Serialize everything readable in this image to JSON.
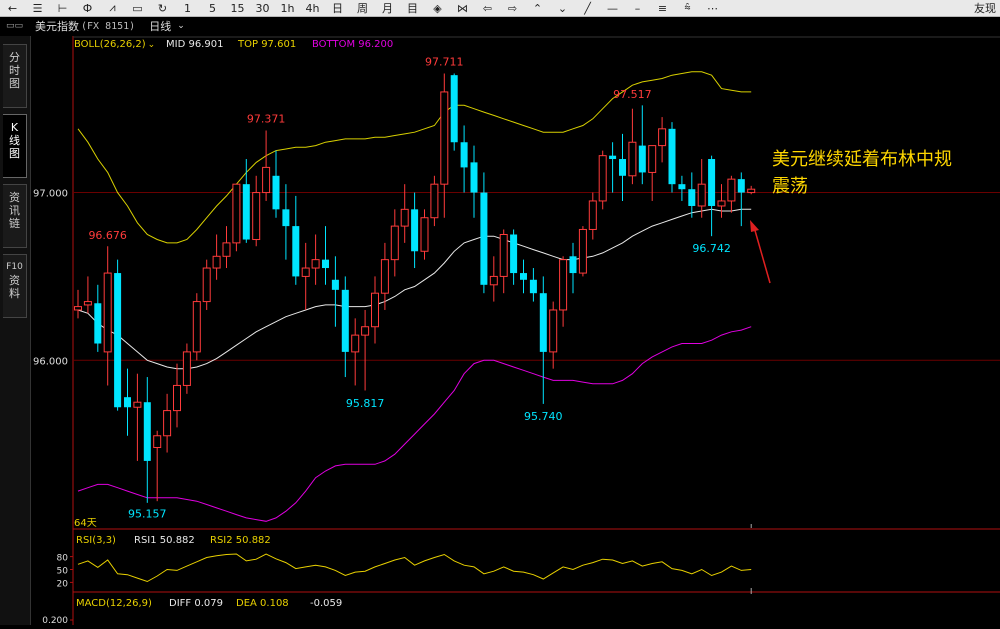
{
  "toolbar": {
    "items": [
      {
        "name": "back-arrow-icon",
        "glyph": "←"
      },
      {
        "name": "list-icon",
        "glyph": "☰"
      },
      {
        "name": "candlestick-icon",
        "glyph": "⊢"
      },
      {
        "name": "kline-icon",
        "glyph": "Ф"
      },
      {
        "name": "line-chart-icon",
        "glyph": "⩘"
      },
      {
        "name": "box-icon",
        "glyph": "▭"
      },
      {
        "name": "refresh-icon",
        "glyph": "↻"
      },
      {
        "name": "period-1",
        "label": "1"
      },
      {
        "name": "period-5",
        "label": "5"
      },
      {
        "name": "period-15",
        "label": "15"
      },
      {
        "name": "period-30",
        "label": "30"
      },
      {
        "name": "period-1h",
        "label": "1h"
      },
      {
        "name": "period-4h",
        "label": "4h"
      },
      {
        "name": "period-day",
        "label": "日"
      },
      {
        "name": "period-week",
        "label": "周"
      },
      {
        "name": "period-month",
        "label": "月"
      },
      {
        "name": "period-year",
        "label": "目"
      },
      {
        "name": "eye-icon",
        "glyph": "◈"
      },
      {
        "name": "cross-icon",
        "glyph": "⋈"
      },
      {
        "name": "arrow-left-icon",
        "glyph": "⇦"
      },
      {
        "name": "arrow-right-icon",
        "glyph": "⇨"
      },
      {
        "name": "zoom-in-icon",
        "glyph": "⌃"
      },
      {
        "name": "zoom-out-icon",
        "glyph": "⌄"
      },
      {
        "name": "draw-line-icon",
        "glyph": "╱"
      },
      {
        "name": "hline-icon",
        "glyph": "—"
      },
      {
        "name": "hline2-icon",
        "glyph": "–"
      },
      {
        "name": "channel-icon",
        "glyph": "≡"
      },
      {
        "name": "fib-icon",
        "glyph": "⩯"
      },
      {
        "name": "more-icon",
        "glyph": "⋯"
      }
    ],
    "right_label": "友现"
  },
  "titlebar": {
    "instrument": "美元指数",
    "symbol": "(FX 8151)",
    "period": "日线"
  },
  "sidetabs": [
    {
      "name": "tab-intraday",
      "chars": [
        "分",
        "时",
        "图"
      ],
      "active": false
    },
    {
      "name": "tab-kline",
      "chars": [
        "K",
        "线",
        "图"
      ],
      "active": true
    },
    {
      "name": "tab-news",
      "chars": [
        "资",
        "讯",
        "链"
      ],
      "active": false
    },
    {
      "name": "tab-f10",
      "chars": [
        "F10",
        "资",
        "料"
      ],
      "active": false
    }
  ],
  "main_legend": {
    "label": "BOLL(26,26,2)",
    "mid": "MID 96.901",
    "top": "TOP 97.601",
    "bottom": "BOTTOM 96.200"
  },
  "rsi_legend": {
    "label": "RSI(3,3)",
    "rsi1": "RSI1 50.882",
    "rsi2": "RSI2 50.882"
  },
  "macd_legend": {
    "label": "MACD(12,26,9)",
    "diff": "DIFF 0.079",
    "dea": "DEA 0.108",
    "macd": "-0.059"
  },
  "days_label": "64天",
  "annotation": {
    "line1": "美元继续延着布林中规",
    "line2": "震荡"
  },
  "colors": {
    "up": "#ff3b3b",
    "down": "#00e5ff",
    "boll_top": "#d8d000",
    "boll_mid": "#e8e8e8",
    "boll_bottom": "#e000e0",
    "legend_label": "#e8d000",
    "legend_mid": "#e8e8e8",
    "legend_top": "#e8d000",
    "legend_bottom": "#e000e0",
    "rsi_line": "#e8d000",
    "annotation": "#ffd700",
    "arrow": "#e02020"
  },
  "chart_data": {
    "type": "candlestick",
    "main": {
      "y_ticks": [
        "97.000",
        "96.000"
      ],
      "y_tick_values": [
        97.0,
        96.0
      ],
      "ylim": [
        95.0,
        97.85
      ],
      "candles": [
        {
          "o": 96.3,
          "h": 96.42,
          "l": 96.25,
          "c": 96.32
        },
        {
          "o": 96.33,
          "h": 96.5,
          "l": 96.28,
          "c": 96.35
        },
        {
          "o": 96.34,
          "h": 96.45,
          "l": 96.05,
          "c": 96.1
        },
        {
          "o": 96.05,
          "h": 96.68,
          "l": 95.85,
          "c": 96.52
        },
        {
          "o": 96.52,
          "h": 96.6,
          "l": 95.7,
          "c": 95.72
        },
        {
          "o": 95.78,
          "h": 95.95,
          "l": 95.55,
          "c": 95.72
        },
        {
          "o": 95.72,
          "h": 95.92,
          "l": 95.4,
          "c": 95.75
        },
        {
          "o": 95.75,
          "h": 95.9,
          "l": 95.15,
          "c": 95.4
        },
        {
          "o": 95.48,
          "h": 95.58,
          "l": 95.16,
          "c": 95.55
        },
        {
          "o": 95.55,
          "h": 95.8,
          "l": 95.45,
          "c": 95.7
        },
        {
          "o": 95.7,
          "h": 95.98,
          "l": 95.6,
          "c": 95.85
        },
        {
          "o": 95.85,
          "h": 96.1,
          "l": 95.8,
          "c": 96.05
        },
        {
          "o": 96.05,
          "h": 96.4,
          "l": 96.0,
          "c": 96.35
        },
        {
          "o": 96.35,
          "h": 96.6,
          "l": 96.3,
          "c": 96.55
        },
        {
          "o": 96.55,
          "h": 96.75,
          "l": 96.48,
          "c": 96.62
        },
        {
          "o": 96.62,
          "h": 96.8,
          "l": 96.55,
          "c": 96.7
        },
        {
          "o": 96.7,
          "h": 97.05,
          "l": 96.65,
          "c": 97.05
        },
        {
          "o": 97.05,
          "h": 97.2,
          "l": 96.7,
          "c": 96.72
        },
        {
          "o": 96.72,
          "h": 97.1,
          "l": 96.68,
          "c": 97.0
        },
        {
          "o": 97.0,
          "h": 97.37,
          "l": 96.95,
          "c": 97.15
        },
        {
          "o": 97.1,
          "h": 97.25,
          "l": 96.85,
          "c": 96.9
        },
        {
          "o": 96.9,
          "h": 97.05,
          "l": 96.6,
          "c": 96.8
        },
        {
          "o": 96.8,
          "h": 96.98,
          "l": 96.45,
          "c": 96.5
        },
        {
          "o": 96.5,
          "h": 96.7,
          "l": 96.3,
          "c": 96.55
        },
        {
          "o": 96.55,
          "h": 96.75,
          "l": 96.45,
          "c": 96.6
        },
        {
          "o": 96.6,
          "h": 96.8,
          "l": 96.45,
          "c": 96.55
        },
        {
          "o": 96.48,
          "h": 96.62,
          "l": 96.2,
          "c": 96.42
        },
        {
          "o": 96.42,
          "h": 96.5,
          "l": 95.9,
          "c": 96.05
        },
        {
          "o": 96.05,
          "h": 96.25,
          "l": 95.85,
          "c": 96.15
        },
        {
          "o": 96.15,
          "h": 96.3,
          "l": 95.82,
          "c": 96.2
        },
        {
          "o": 96.2,
          "h": 96.5,
          "l": 96.1,
          "c": 96.4
        },
        {
          "o": 96.4,
          "h": 96.7,
          "l": 96.3,
          "c": 96.6
        },
        {
          "o": 96.6,
          "h": 96.9,
          "l": 96.5,
          "c": 96.8
        },
        {
          "o": 96.8,
          "h": 97.05,
          "l": 96.7,
          "c": 96.9
        },
        {
          "o": 96.9,
          "h": 97.0,
          "l": 96.55,
          "c": 96.65
        },
        {
          "o": 96.65,
          "h": 96.9,
          "l": 96.6,
          "c": 96.85
        },
        {
          "o": 96.85,
          "h": 97.1,
          "l": 96.8,
          "c": 97.05
        },
        {
          "o": 97.05,
          "h": 97.71,
          "l": 96.85,
          "c": 97.6
        },
        {
          "o": 97.7,
          "h": 97.71,
          "l": 97.25,
          "c": 97.3
        },
        {
          "o": 97.3,
          "h": 97.4,
          "l": 97.0,
          "c": 97.15
        },
        {
          "o": 97.18,
          "h": 97.28,
          "l": 96.85,
          "c": 97.0
        },
        {
          "o": 97.0,
          "h": 97.12,
          "l": 96.4,
          "c": 96.45
        },
        {
          "o": 96.45,
          "h": 96.62,
          "l": 96.35,
          "c": 96.5
        },
        {
          "o": 96.5,
          "h": 96.78,
          "l": 96.4,
          "c": 96.75
        },
        {
          "o": 96.75,
          "h": 96.78,
          "l": 96.45,
          "c": 96.52
        },
        {
          "o": 96.52,
          "h": 96.6,
          "l": 96.4,
          "c": 96.48
        },
        {
          "o": 96.48,
          "h": 96.55,
          "l": 96.35,
          "c": 96.4
        },
        {
          "o": 96.4,
          "h": 96.5,
          "l": 95.74,
          "c": 96.05
        },
        {
          "o": 96.05,
          "h": 96.35,
          "l": 95.95,
          "c": 96.3
        },
        {
          "o": 96.3,
          "h": 96.62,
          "l": 96.2,
          "c": 96.6
        },
        {
          "o": 96.62,
          "h": 96.7,
          "l": 96.4,
          "c": 96.52
        },
        {
          "o": 96.52,
          "h": 96.8,
          "l": 96.5,
          "c": 96.78
        },
        {
          "o": 96.78,
          "h": 97.0,
          "l": 96.72,
          "c": 96.95
        },
        {
          "o": 96.95,
          "h": 97.25,
          "l": 96.9,
          "c": 97.22
        },
        {
          "o": 97.22,
          "h": 97.3,
          "l": 97.0,
          "c": 97.2
        },
        {
          "o": 97.2,
          "h": 97.35,
          "l": 96.95,
          "c": 97.1
        },
        {
          "o": 97.1,
          "h": 97.5,
          "l": 97.05,
          "c": 97.3
        },
        {
          "o": 97.28,
          "h": 97.52,
          "l": 97.05,
          "c": 97.12
        },
        {
          "o": 97.12,
          "h": 97.28,
          "l": 96.95,
          "c": 97.28
        },
        {
          "o": 97.28,
          "h": 97.45,
          "l": 97.18,
          "c": 97.38
        },
        {
          "o": 97.38,
          "h": 97.42,
          "l": 97.0,
          "c": 97.05
        },
        {
          "o": 97.05,
          "h": 97.1,
          "l": 96.95,
          "c": 97.02
        },
        {
          "o": 97.02,
          "h": 97.12,
          "l": 96.85,
          "c": 96.92
        },
        {
          "o": 96.92,
          "h": 97.2,
          "l": 96.85,
          "c": 97.05
        },
        {
          "o": 97.2,
          "h": 97.22,
          "l": 96.74,
          "c": 96.92
        },
        {
          "o": 96.92,
          "h": 97.05,
          "l": 96.85,
          "c": 96.95
        },
        {
          "o": 96.95,
          "h": 97.1,
          "l": 96.88,
          "c": 97.08
        },
        {
          "o": 97.08,
          "h": 97.12,
          "l": 96.8,
          "c": 97.0
        },
        {
          "o": 97.0,
          "h": 97.04,
          "l": 96.99,
          "c": 97.02
        }
      ],
      "boll_top": [
        97.38,
        97.3,
        97.2,
        97.12,
        97.0,
        96.92,
        96.82,
        96.75,
        96.72,
        96.7,
        96.7,
        96.72,
        96.78,
        96.85,
        96.92,
        96.98,
        97.05,
        97.12,
        97.18,
        97.22,
        97.25,
        97.26,
        97.27,
        97.27,
        97.28,
        97.3,
        97.31,
        97.32,
        97.32,
        97.32,
        97.33,
        97.33,
        97.34,
        97.35,
        97.36,
        97.38,
        97.4,
        97.48,
        97.52,
        97.52,
        97.5,
        97.48,
        97.46,
        97.44,
        97.42,
        97.4,
        97.38,
        97.36,
        97.36,
        97.36,
        97.38,
        97.4,
        97.44,
        97.5,
        97.56,
        97.6,
        97.64,
        97.66,
        97.67,
        97.68,
        97.7,
        97.71,
        97.72,
        97.72,
        97.7,
        97.62,
        97.61,
        97.6,
        97.6
      ],
      "boll_mid": [
        96.3,
        96.28,
        96.22,
        96.18,
        96.15,
        96.1,
        96.05,
        96.0,
        95.98,
        95.96,
        95.95,
        95.95,
        95.96,
        95.98,
        96.01,
        96.05,
        96.09,
        96.13,
        96.17,
        96.2,
        96.23,
        96.26,
        96.28,
        96.3,
        96.32,
        96.33,
        96.33,
        96.32,
        96.32,
        96.32,
        96.33,
        96.35,
        96.38,
        96.42,
        96.44,
        96.48,
        96.52,
        96.58,
        96.65,
        96.7,
        96.72,
        96.74,
        96.74,
        96.72,
        96.7,
        96.68,
        96.66,
        96.64,
        96.62,
        96.6,
        96.6,
        96.61,
        96.62,
        96.64,
        96.67,
        96.7,
        96.74,
        96.77,
        96.8,
        96.82,
        96.84,
        96.86,
        96.88,
        96.89,
        96.9,
        96.89,
        96.89,
        96.9,
        96.9
      ],
      "boll_bottom": [
        95.22,
        95.24,
        95.26,
        95.26,
        95.24,
        95.22,
        95.2,
        95.18,
        95.18,
        95.18,
        95.18,
        95.17,
        95.16,
        95.14,
        95.12,
        95.1,
        95.08,
        95.06,
        95.05,
        95.04,
        95.06,
        95.1,
        95.15,
        95.22,
        95.3,
        95.34,
        95.37,
        95.38,
        95.38,
        95.38,
        95.38,
        95.4,
        95.44,
        95.5,
        95.56,
        95.62,
        95.68,
        95.75,
        95.82,
        95.92,
        95.98,
        96.0,
        96.0,
        95.98,
        95.96,
        95.94,
        95.92,
        95.9,
        95.88,
        95.88,
        95.88,
        95.87,
        95.86,
        95.86,
        95.86,
        95.88,
        95.92,
        95.98,
        96.02,
        96.05,
        96.08,
        96.1,
        96.1,
        96.1,
        96.12,
        96.15,
        96.17,
        96.18,
        96.2
      ],
      "annotations": [
        {
          "text": "96.676",
          "i": 3,
          "value": 96.676,
          "pos": "above",
          "color": "up"
        },
        {
          "text": "95.157",
          "i": 7,
          "value": 95.157,
          "pos": "below",
          "color": "down"
        },
        {
          "text": "97.371",
          "i": 19,
          "value": 97.371,
          "pos": "above",
          "color": "up"
        },
        {
          "text": "95.817",
          "i": 29,
          "value": 95.817,
          "pos": "below",
          "color": "down"
        },
        {
          "text": "97.711",
          "i": 37,
          "value": 97.711,
          "pos": "above",
          "color": "up"
        },
        {
          "text": "95.740",
          "i": 47,
          "value": 95.74,
          "pos": "below",
          "color": "down"
        },
        {
          "text": "97.517",
          "i": 56,
          "value": 97.517,
          "pos": "above",
          "color": "up"
        },
        {
          "text": "96.742",
          "i": 64,
          "value": 96.742,
          "pos": "below",
          "color": "down"
        }
      ]
    },
    "rsi": {
      "y_ticks": [
        "80",
        "50",
        "20"
      ],
      "y_tick_values": [
        80,
        50,
        20
      ],
      "ylim": [
        0,
        100
      ],
      "values": [
        62,
        70,
        55,
        72,
        40,
        38,
        30,
        22,
        35,
        50,
        48,
        58,
        68,
        78,
        82,
        85,
        86,
        70,
        74,
        86,
        75,
        66,
        52,
        56,
        60,
        56,
        48,
        36,
        44,
        46,
        56,
        64,
        72,
        78,
        60,
        70,
        78,
        85,
        70,
        60,
        56,
        40,
        46,
        56,
        46,
        44,
        38,
        28,
        42,
        56,
        50,
        60,
        66,
        74,
        72,
        64,
        70,
        58,
        64,
        68,
        52,
        48,
        40,
        50,
        36,
        44,
        58,
        48,
        50
      ]
    },
    "macd": {
      "y_ticks": [
        "0.200"
      ],
      "y_tick_values": [
        0.2
      ],
      "ylim": [
        -0.2,
        0.25
      ]
    }
  }
}
